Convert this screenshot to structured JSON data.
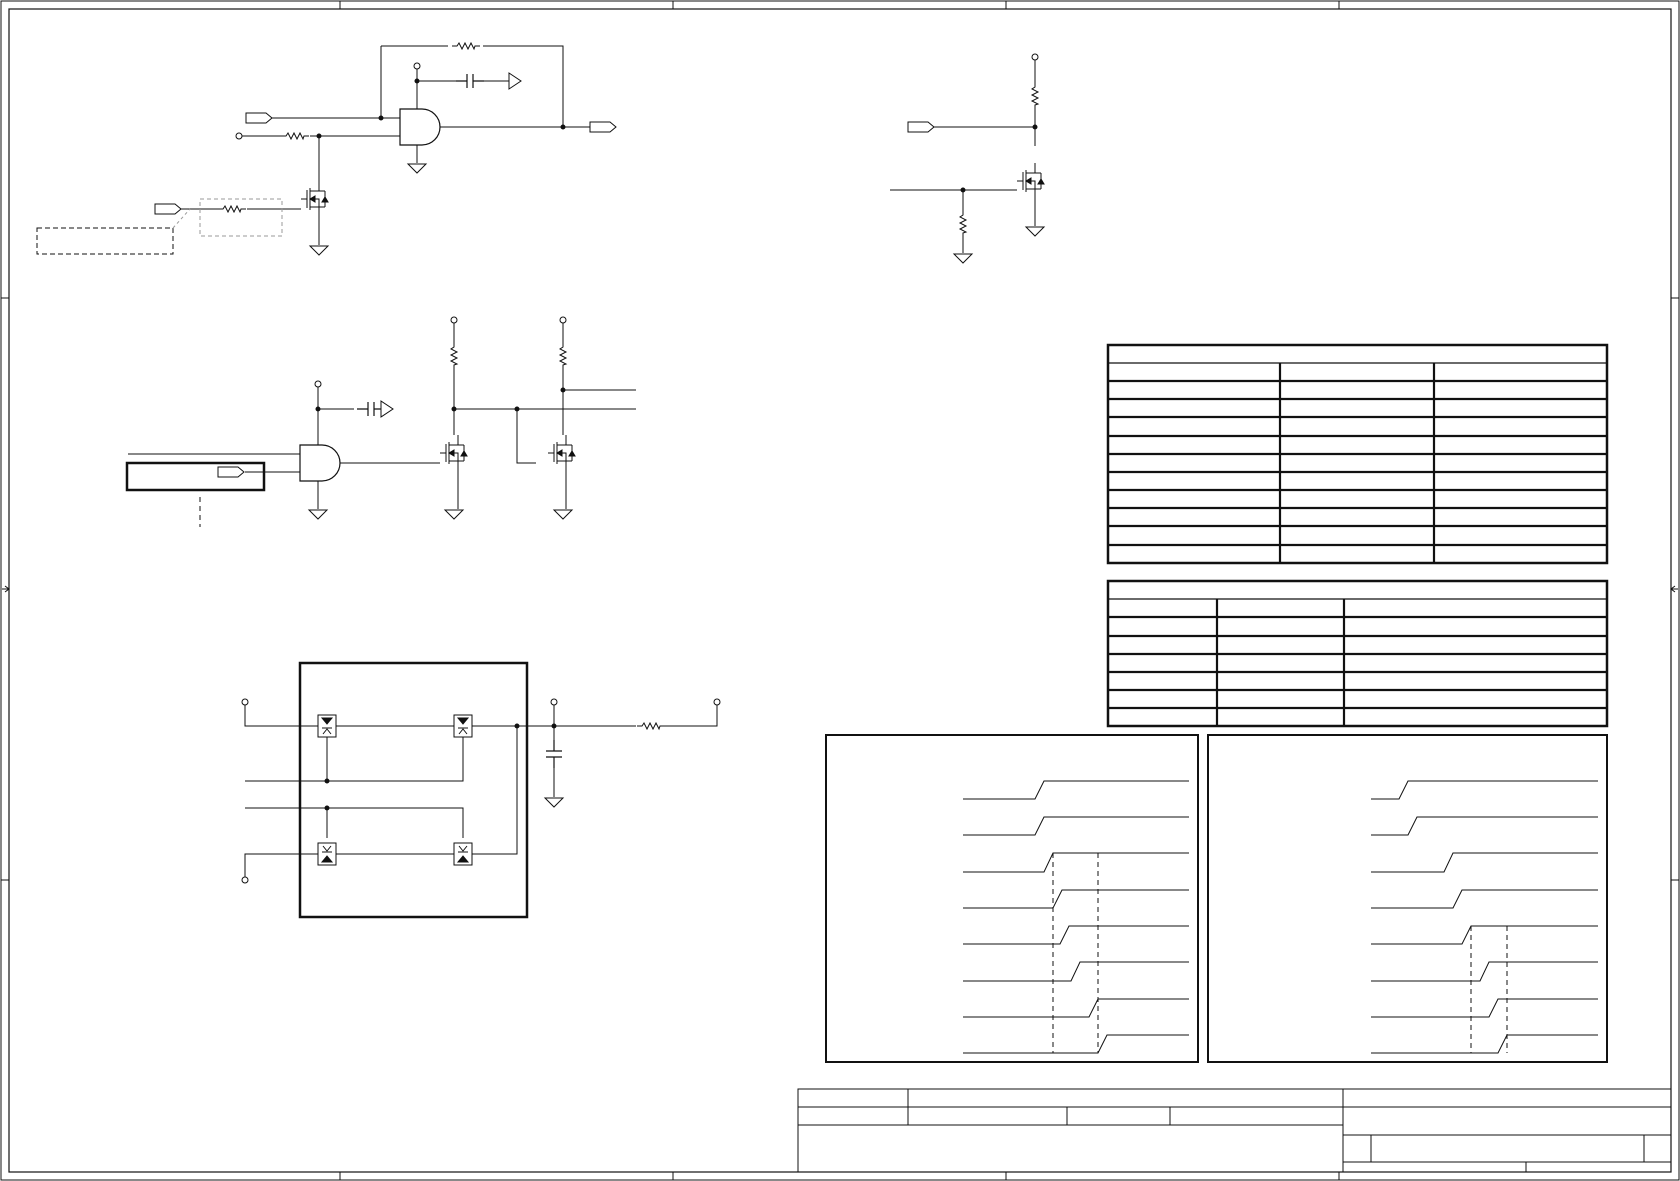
{
  "sheet": {
    "title_block": {
      "fields": []
    }
  },
  "colors": {
    "ink": "#111111",
    "faint": "#9a9a9a",
    "background": "#ffffff"
  },
  "tables": {
    "upper": {
      "columns": 3,
      "rows": 10
    },
    "lower": {
      "columns": 3,
      "rows": 6
    }
  },
  "timing_diagrams": {
    "left": {
      "signals": 8
    },
    "right": {
      "signals": 8
    }
  }
}
